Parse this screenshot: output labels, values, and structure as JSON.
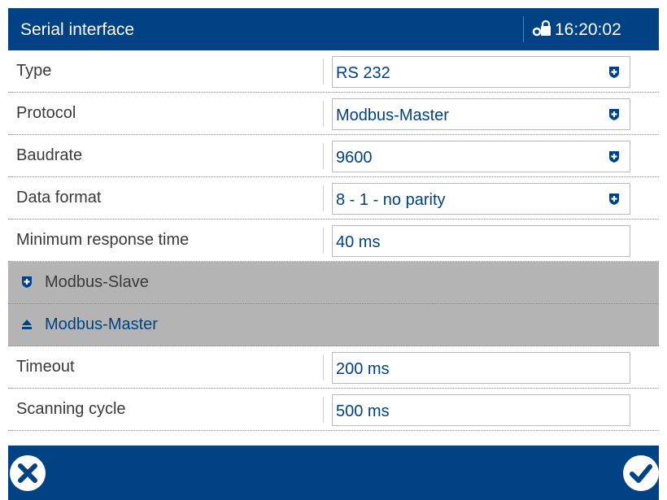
{
  "header": {
    "title": "Serial interface",
    "time": "16:20:02",
    "status_icon": "lock-icon"
  },
  "settings": [
    {
      "label": "Type",
      "value": "RS 232",
      "control": "dropdown"
    },
    {
      "label": "Protocol",
      "value": "Modbus-Master",
      "control": "dropdown"
    },
    {
      "label": "Baudrate",
      "value": "9600",
      "control": "dropdown"
    },
    {
      "label": "Data format",
      "value": "8 - 1 - no parity",
      "control": "dropdown"
    },
    {
      "label": "Minimum response time",
      "value": "40 ms",
      "control": "input"
    }
  ],
  "sections": [
    {
      "label": "Modbus-Slave",
      "state": "collapsed"
    },
    {
      "label": "Modbus-Master",
      "state": "expanded"
    }
  ],
  "master_settings": [
    {
      "label": "Timeout",
      "value": "200 ms",
      "control": "input"
    },
    {
      "label": "Scanning cycle",
      "value": "500 ms",
      "control": "input"
    }
  ],
  "footer": {
    "cancel_icon": "close-circle-icon",
    "confirm_icon": "check-circle-icon"
  },
  "colors": {
    "brand": "#004283",
    "section_bg": "#b4b4b4",
    "value_text": "#004283",
    "label_text": "#3a3a3a"
  }
}
